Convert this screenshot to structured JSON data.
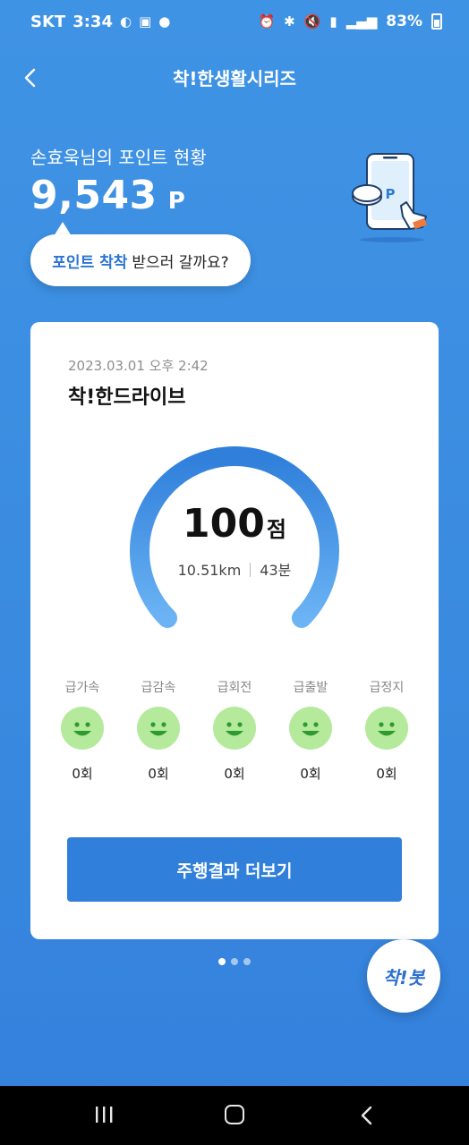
{
  "status_bar": {
    "carrier": "SKT",
    "time": "3:34",
    "battery": "83%"
  },
  "header": {
    "title": "착!한생활시리즈"
  },
  "points": {
    "owner_label": "손효욱님의 포인트 현황",
    "amount": "9,543",
    "unit": "P"
  },
  "bubble": {
    "highlight": "포인트 착착",
    "text": "받으러 갈까요?"
  },
  "card": {
    "datetime": "2023.03.01 오후 2:42",
    "title": "착!한드라이브",
    "score": "100",
    "score_unit": "점",
    "distance": "10.51km",
    "duration": "43분",
    "gauge_fraction": 1.0,
    "events": [
      {
        "label": "급가속",
        "count": "0회"
      },
      {
        "label": "급감속",
        "count": "0회"
      },
      {
        "label": "급회전",
        "count": "0회"
      },
      {
        "label": "급출발",
        "count": "0회"
      },
      {
        "label": "급정지",
        "count": "0회"
      }
    ],
    "more_button": "주행결과 더보기"
  },
  "pager": {
    "total": 3,
    "active": 1
  },
  "fab": {
    "label": "착!봇"
  },
  "colors": {
    "accent": "#2f7fdb",
    "background": "#3f93e4",
    "face": "#b5ea9c"
  }
}
